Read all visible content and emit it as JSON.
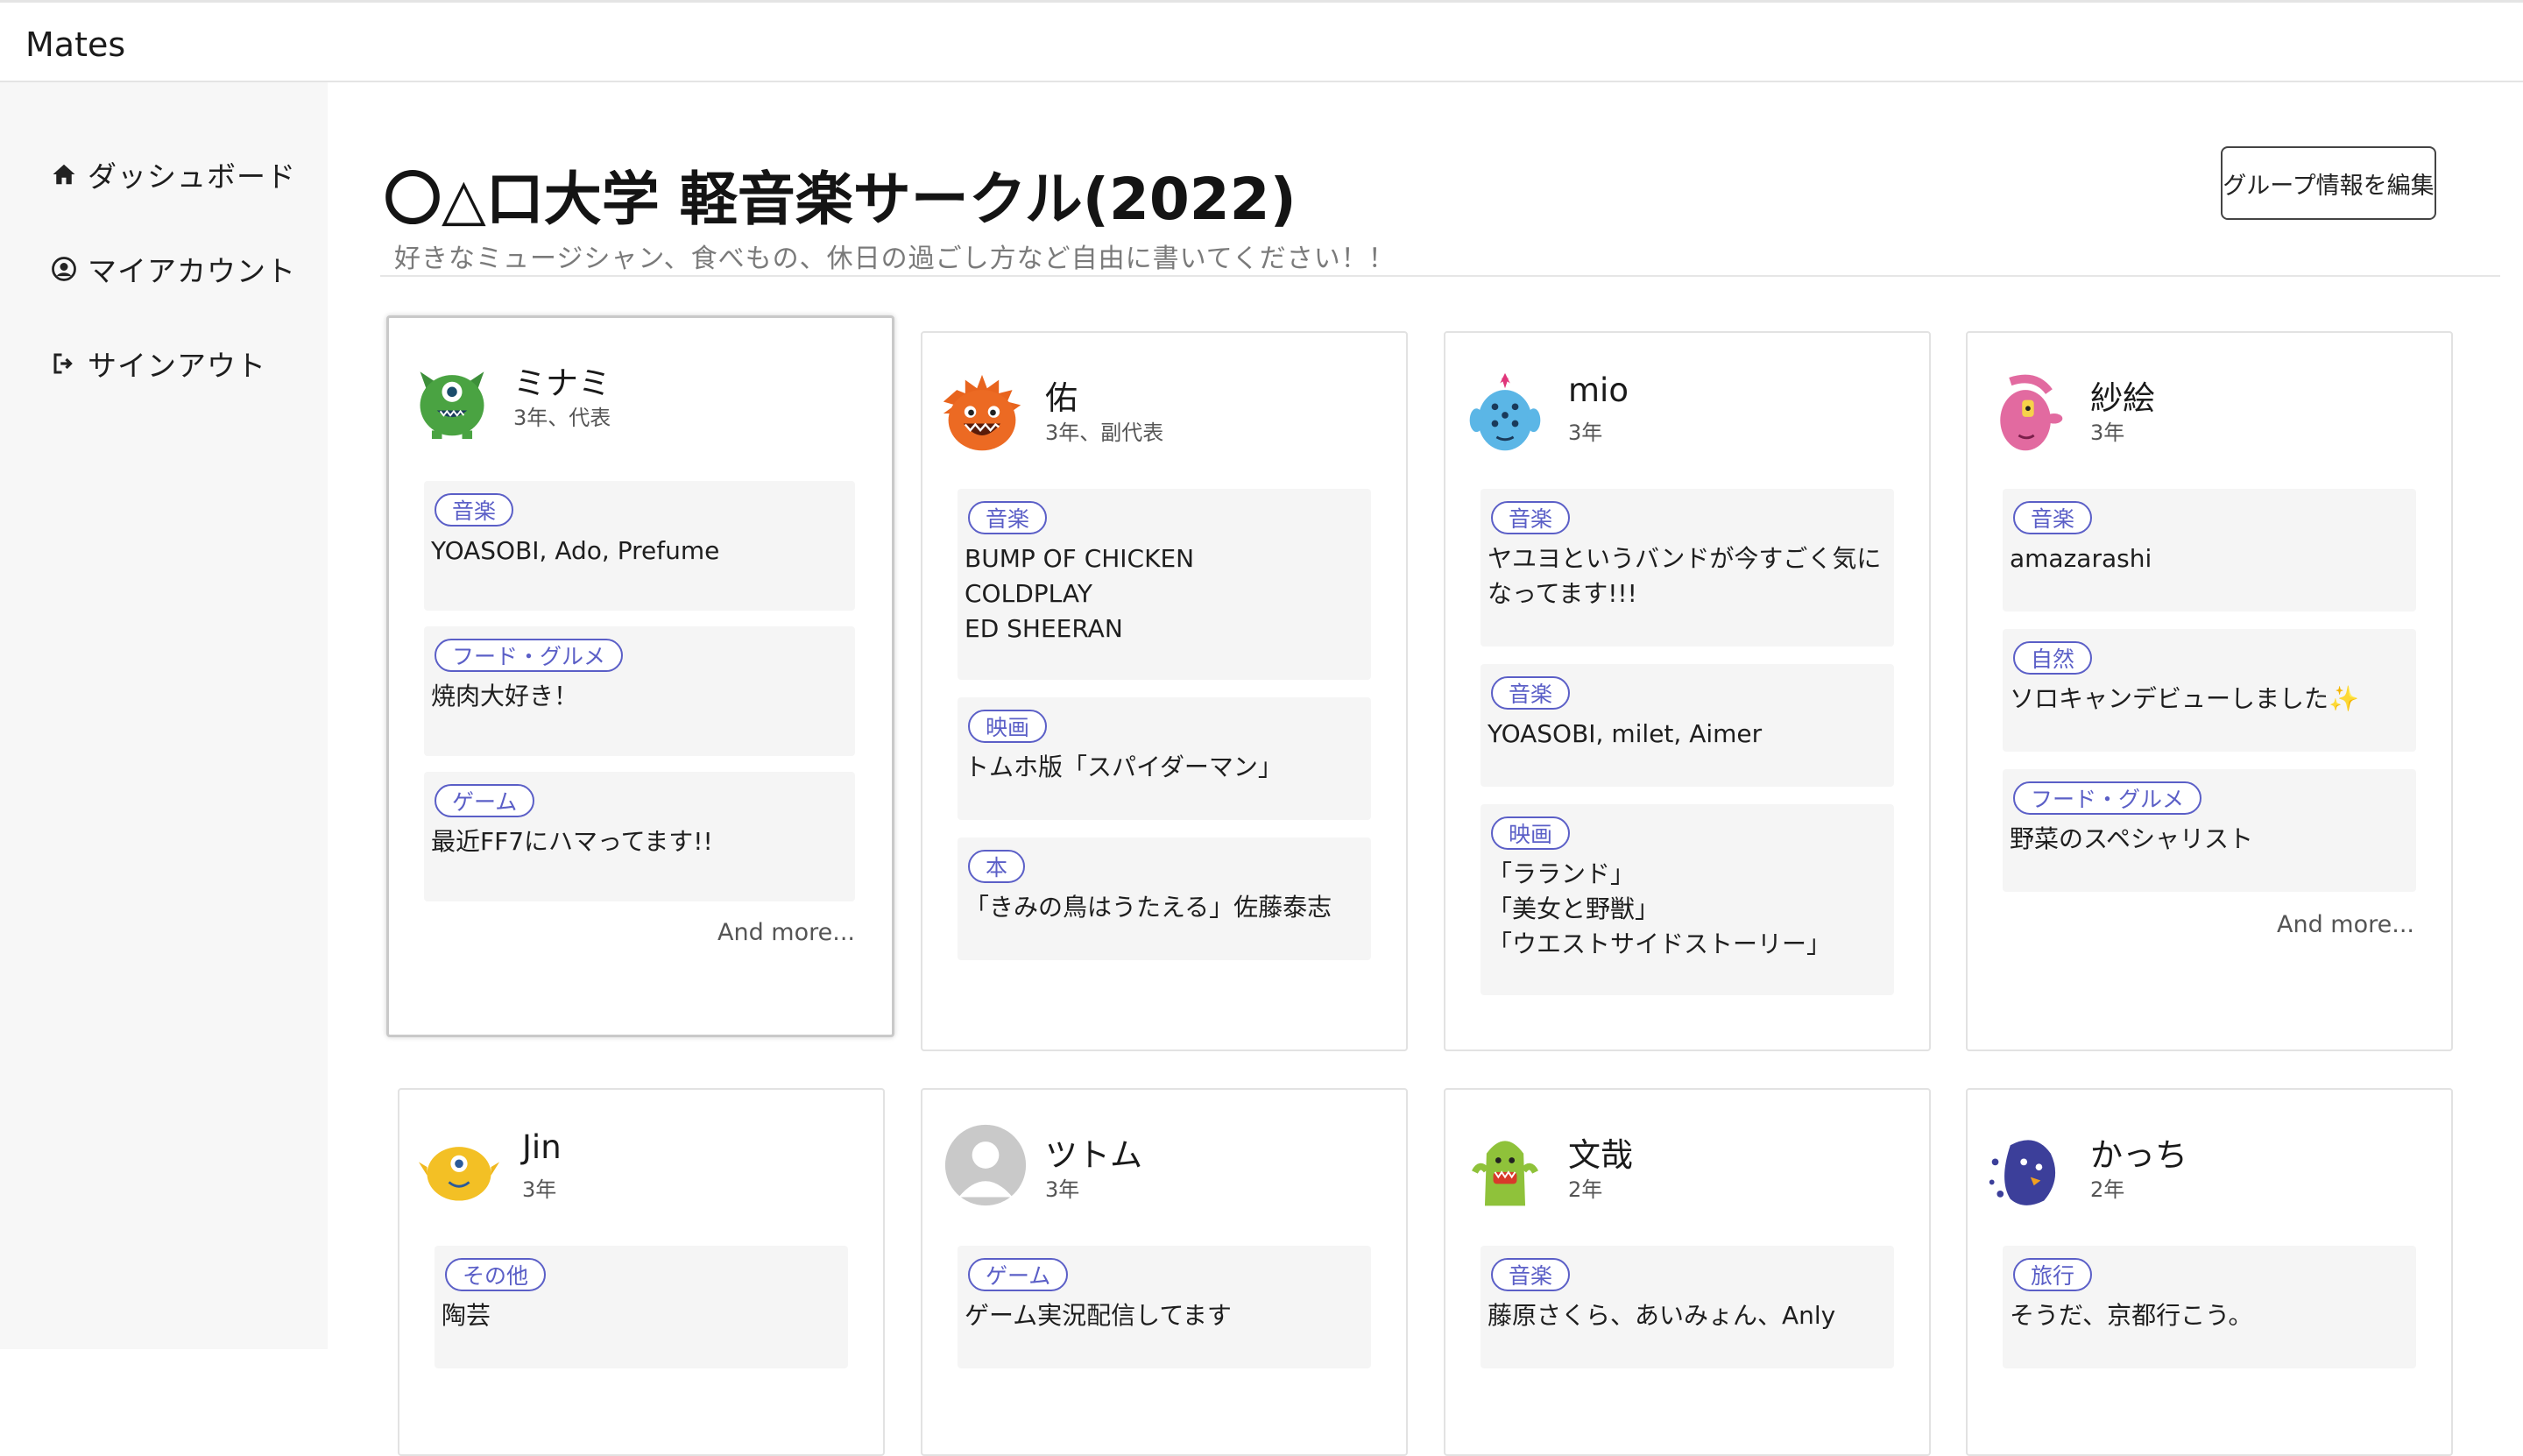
{
  "app": {
    "title": "Mates"
  },
  "sidebar": {
    "items": [
      {
        "label": "ダッシュボード",
        "icon": "home-icon"
      },
      {
        "label": "マイアカウント",
        "icon": "user-circle-icon"
      },
      {
        "label": "サインアウト",
        "icon": "sign-out-icon"
      }
    ]
  },
  "group": {
    "title": "〇△口大学 軽音楽サークル(2022)",
    "description": "好きなミュージシャン、食べもの、休日の過ごし方など自由に書いてください！！",
    "edit_label": "グループ情報を編集"
  },
  "colors": {
    "tag": "#5b5fc7",
    "section_bg": "#f5f5f5",
    "sidebar_bg": "#f7f7f7"
  },
  "members": [
    {
      "name": "ミナミ",
      "role": "3年、代表",
      "avatar": "green-monster-avatar",
      "sections": [
        {
          "tag": "音楽",
          "text": "YOASOBI, Ado, Prefume"
        },
        {
          "tag": "フード・グルメ",
          "text": "焼肉大好き！"
        },
        {
          "tag": "ゲーム",
          "text": "最近FF7にハマってます!!"
        }
      ],
      "more": "And more..."
    },
    {
      "name": "佑",
      "role": "3年、副代表",
      "avatar": "orange-monster-avatar",
      "sections": [
        {
          "tag": "音楽",
          "text": "BUMP OF CHICKEN\nCOLDPLAY\nED SHEERAN"
        },
        {
          "tag": "映画",
          "text": "トムホ版「スパイダーマン」"
        },
        {
          "tag": "本",
          "text": "「きみの鳥はうたえる」佐藤泰志"
        }
      ]
    },
    {
      "name": "mio",
      "role": "3年",
      "avatar": "blue-monster-avatar",
      "sections": [
        {
          "tag": "音楽",
          "text": "ヤユヨというバンドが今すごく気になってます!!!"
        },
        {
          "tag": "音楽",
          "text": "YOASOBI, milet, Aimer"
        },
        {
          "tag": "映画",
          "text": "「ラランド」\n「美女と野獣」\n「ウエストサイドストーリー」"
        }
      ]
    },
    {
      "name": "紗絵",
      "role": "3年",
      "avatar": "pink-monster-avatar",
      "sections": [
        {
          "tag": "音楽",
          "text": "amazarashi"
        },
        {
          "tag": "自然",
          "text": "ソロキャンデビューしました✨"
        },
        {
          "tag": "フード・グルメ",
          "text": "野菜のスペシャリスト"
        }
      ],
      "more": "And more..."
    },
    {
      "name": "Jin",
      "role": "3年",
      "avatar": "yellow-monster-avatar",
      "sections": [
        {
          "tag": "その他",
          "text": "陶芸"
        }
      ]
    },
    {
      "name": "ツトム",
      "role": "3年",
      "avatar": "default-user-avatar",
      "sections": [
        {
          "tag": "ゲーム",
          "text": "ゲーム実況配信してます"
        }
      ]
    },
    {
      "name": "文哉",
      "role": "2年",
      "avatar": "lime-monster-avatar",
      "sections": [
        {
          "tag": "音楽",
          "text": "藤原さくら、あいみょん、Anly"
        }
      ]
    },
    {
      "name": "かっち",
      "role": "2年",
      "avatar": "navy-monster-avatar",
      "sections": [
        {
          "tag": "旅行",
          "text": "そうだ、京都行こう。"
        }
      ]
    }
  ]
}
